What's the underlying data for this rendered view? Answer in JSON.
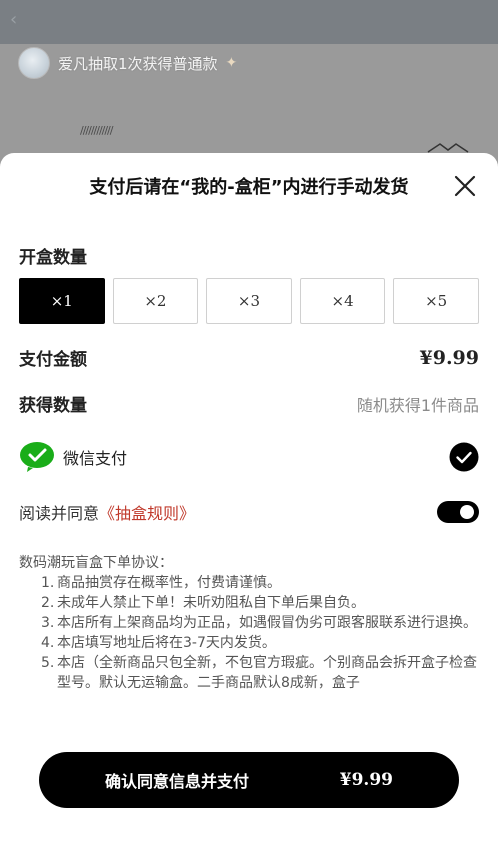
{
  "background": {
    "back_icon": "chevron-left-icon",
    "banner_text": "爱凡抽取1次获得普通款",
    "decor_text": "////////////"
  },
  "sheet": {
    "title": "支付后请在“我的-盒柜”内进行手动发货",
    "close_icon": "close-icon"
  },
  "quantity": {
    "label": "开盒数量",
    "options": [
      "×1",
      "×2",
      "×3",
      "×4",
      "×5"
    ],
    "selected_index": 0
  },
  "payment_amount": {
    "label": "支付金额",
    "value": "¥9.99"
  },
  "obtain_quantity": {
    "label": "获得数量",
    "value": "随机获得1件商品"
  },
  "payment_method": {
    "label": "微信支付",
    "icon": "wechat-icon",
    "selected": true,
    "accent_color": "#1AAD19"
  },
  "agreement": {
    "prefix": "阅读并同意",
    "link": "《抽盒规则》",
    "toggle_on": true,
    "link_color": "#c0392b"
  },
  "protocol": {
    "title": "数码潮玩盲盒下单协议：",
    "items": [
      {
        "num": "1.",
        "text": "商品抽赏存在概率性，付费请谨慎。"
      },
      {
        "num": "2.",
        "text": "未成年人禁止下单！未听劝阻私自下单后果自负。"
      },
      {
        "num": "3.",
        "text": "本店所有上架商品均为正品，如遇假冒伪劣可跟客服联系进行退换。"
      },
      {
        "num": "4.",
        "text": "本店填写地址后将在3-7天内发货。"
      },
      {
        "num": "5.",
        "text": "本店（全新商品只包全新，不包官方瑕疵。个别商品会拆开盒子检查型号。默认无运输盒。二手商品默认8成新，盒子"
      }
    ]
  },
  "confirm": {
    "label": "确认同意信息并支付",
    "price": "¥9.99"
  }
}
